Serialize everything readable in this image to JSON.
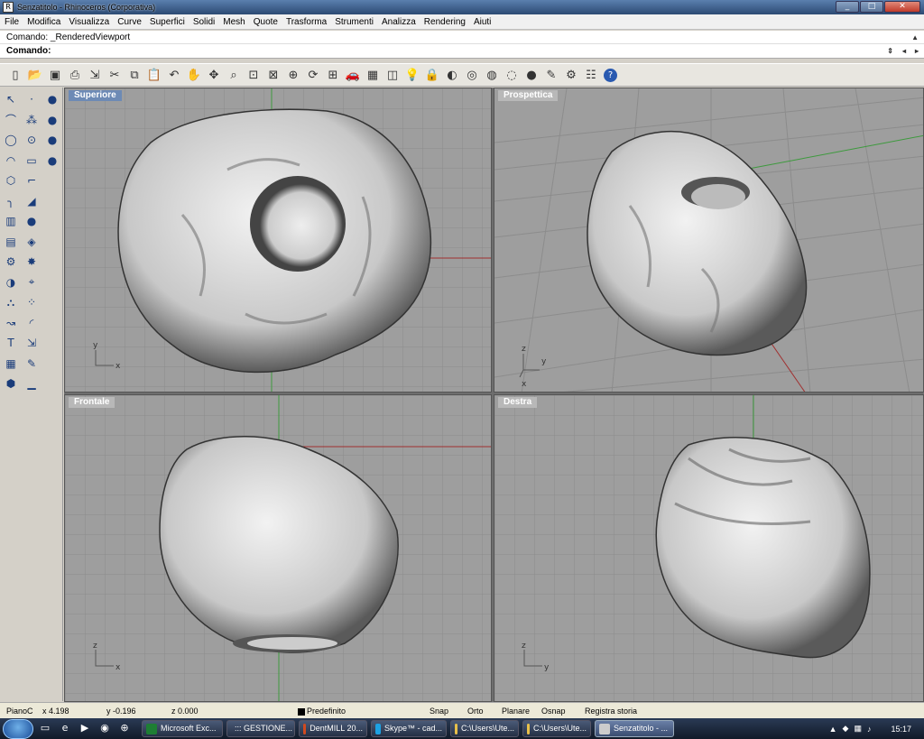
{
  "window": {
    "title": "Senzatitolo - Rhinoceros (Corporativa)",
    "buttons": [
      "minimize",
      "maximize",
      "close"
    ]
  },
  "menu": [
    "File",
    "Modifica",
    "Visualizza",
    "Curve",
    "Superfici",
    "Solidi",
    "Mesh",
    "Quote",
    "Trasforma",
    "Strumenti",
    "Analizza",
    "Rendering",
    "Aiuti"
  ],
  "command": {
    "history": "Comando: _RenderedViewport",
    "prompt": "Comando:",
    "value": ""
  },
  "toolbar_icons": [
    "new-icon",
    "open-icon",
    "save-icon",
    "print-icon",
    "import-icon",
    "cut-icon",
    "copy-icon",
    "paste-icon",
    "undo-icon",
    "pan-icon",
    "move-view-icon",
    "zoom-icon",
    "zoom-window-icon",
    "zoom-extents-icon",
    "zoom-selected-icon",
    "rotate-view-icon",
    "four-views-icon",
    "car-icon",
    "grid-icon",
    "layer-icon",
    "light-icon",
    "lock-icon",
    "shade-icon",
    "color-wheel-icon",
    "render-mode-icon",
    "ghosted-icon",
    "sphere-render-icon",
    "options-icon",
    "settings-icon",
    "properties-icon",
    "help-icon"
  ],
  "left_toolbar": {
    "col1": [
      "select-arrow-icon",
      "polyline-icon",
      "circle-icon",
      "arc-icon",
      "polygon-icon",
      "fillet-icon",
      "box-solid-icon",
      "cylinder-icon",
      "gear-icon",
      "boolean-icon",
      "union-icon",
      "curve-icon",
      "text-icon",
      "grid-array-icon",
      "cube-icon"
    ],
    "col2": [
      "point-icon",
      "curve-points-icon",
      "ellipse-icon",
      "rectangle-icon",
      "curve-trim-icon",
      "surface-icon",
      "sphere-icon",
      "surface-edit-icon",
      "explode-icon",
      "trim-icon",
      "array-icon",
      "blend-icon",
      "scale-icon",
      "edit-icon",
      "dimension-icon"
    ],
    "col3": [
      "sphere-blue-icon",
      "sphere-mesh-icon",
      "sphere-grey-icon",
      "sphere-split-icon"
    ]
  },
  "viewports": {
    "top": {
      "label": "Superiore",
      "axes": [
        "y",
        "x"
      ]
    },
    "perspective": {
      "label": "Prospettica",
      "axes": [
        "z",
        "y",
        "x"
      ]
    },
    "front": {
      "label": "Frontale",
      "axes": [
        "z",
        "x"
      ]
    },
    "right": {
      "label": "Destra",
      "axes": [
        "z",
        "y"
      ]
    }
  },
  "status": {
    "plane": "PianoC",
    "x": "x 4.198",
    "y": "y -0.196",
    "z": "z 0.000",
    "layer": "Predefinito",
    "snap": "Snap",
    "ortho": "Orto",
    "planar": "Planare",
    "osnap": "Osnap",
    "history": "Registra storia"
  },
  "taskbar": {
    "tasks": [
      {
        "label": "Microsoft Exc...",
        "color": "#1e7e34"
      },
      {
        "label": "::: GESTIONE...",
        "color": "#e07020"
      },
      {
        "label": "DentMILL 20...",
        "color": "#d04a20"
      },
      {
        "label": "Skype™ - cad...",
        "color": "#1da1e2"
      },
      {
        "label": "C:\\Users\\Ute...",
        "color": "#e8c04a"
      },
      {
        "label": "C:\\Users\\Ute...",
        "color": "#e8c04a"
      },
      {
        "label": "Senzatitolo - ...",
        "color": "#cccccc"
      }
    ],
    "clock": "15:17"
  }
}
